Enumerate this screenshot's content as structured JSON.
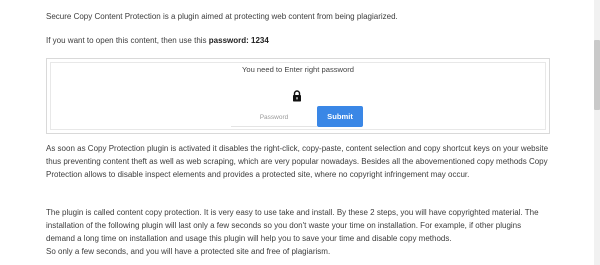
{
  "intro": {
    "line1": "Secure Copy Content Protection is a plugin aimed at protecting web content from being plagiarized.",
    "line2_prefix": "If you want to open this content, then use this ",
    "line2_bold": "password: 1234"
  },
  "protection_box": {
    "message": "You need to Enter right password",
    "icon": "lock-icon",
    "password_placeholder": "Password",
    "submit_label": "Submit",
    "submit_color": "#3a87e6"
  },
  "paragraph1": {
    "lines": [
      "As soon as Copy Protection plugin is activated it disables the right-click, copy-paste, content selection and copy shortcut keys on your website",
      "thus preventing content theft as well as web scraping, which are very popular nowadays. Besides all the abovementioned copy methods Copy",
      "Protection allows to disable inspect elements and provides a protected site, where no copyright infringement may occur."
    ]
  },
  "paragraph2": {
    "lines": [
      "The plugin is called content copy protection. It is very easy to use take and install. By these 2 steps, you will have copyrighted material. The",
      "installation of the following plugin will last only a few seconds so you don't waste your time on installation. For example, if other plugins",
      "demand a long time on installation and usage this plugin will help you to save your time and disable copy methods.",
      "So only a few seconds, and you will have a protected site and free of plagiarism."
    ]
  }
}
